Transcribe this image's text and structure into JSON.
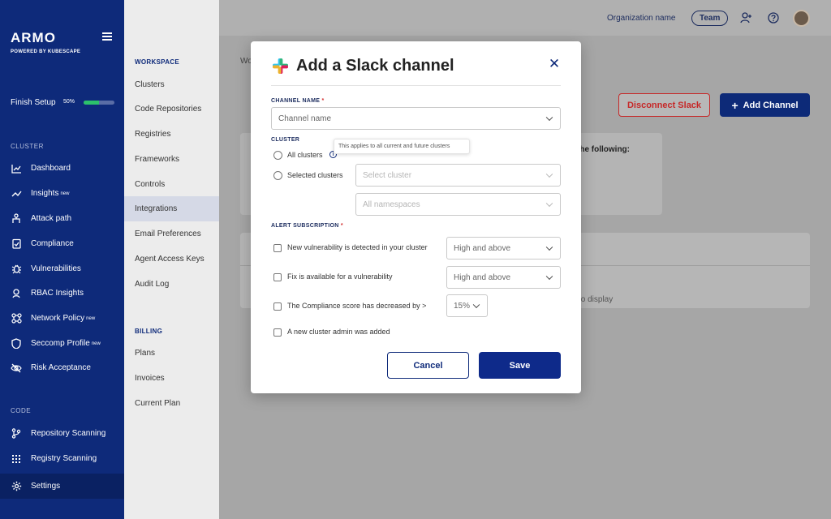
{
  "nav": {
    "logo": "ARMO",
    "powered": "POWERED BY KUBESCAPE",
    "setup_label": "Finish Setup",
    "setup_percent": "50%",
    "setup_progress": 0.5,
    "cluster_section": "CLUSTER",
    "code_section": "CODE",
    "items": [
      {
        "label": "Dashboard",
        "icon": "chart-icon",
        "new": ""
      },
      {
        "label": "Insights",
        "icon": "trend-icon",
        "new": "new"
      },
      {
        "label": "Attack path",
        "icon": "attack-path-icon",
        "new": ""
      },
      {
        "label": "Compliance",
        "icon": "clipboard-icon",
        "new": ""
      },
      {
        "label": "Vulnerabilities",
        "icon": "bug-icon",
        "new": ""
      },
      {
        "label": "RBAC Insights",
        "icon": "rbac-icon",
        "new": ""
      },
      {
        "label": "Network Policy",
        "icon": "network-icon",
        "new": "new"
      },
      {
        "label": "Seccomp Profile",
        "icon": "shield-icon",
        "new": "new"
      },
      {
        "label": "Risk Acceptance",
        "icon": "eye-off-icon",
        "new": ""
      }
    ],
    "code_items": [
      {
        "label": "Repository Scanning",
        "icon": "git-branch-icon"
      },
      {
        "label": "Registry Scanning",
        "icon": "grid-icon"
      }
    ],
    "settings_label": "Settings"
  },
  "subnav": {
    "workspace_section": "WORKSPACE",
    "workspace_links": [
      "Clusters",
      "Code Repositories",
      "Registries",
      "Frameworks",
      "Controls",
      "Integrations",
      "Email Preferences",
      "Agent Access Keys",
      "Audit Log"
    ],
    "billing_section": "BILLING",
    "billing_links": [
      "Plans",
      "Invoices",
      "Current Plan"
    ]
  },
  "topbar": {
    "org_name": "Organization name",
    "team": "Team"
  },
  "page": {
    "crumb": "Wo",
    "disconnect_label": "Disconnect Slack",
    "add_channel_label": "Add Channel",
    "follow_text": "the following:",
    "empty_text": "to display"
  },
  "modal": {
    "title": "Add a Slack channel",
    "channel_name_label": "CHANNEL NAME",
    "channel_name_placeholder": "Channel name",
    "cluster_label": "CLUSTER",
    "all_clusters": "All clusters",
    "tooltip": "This applies to all current and future clusters",
    "selected_clusters": "Selected clusters",
    "select_cluster_placeholder": "Select cluster",
    "namespaces_placeholder": "All namespaces",
    "alert_label": "ALERT SUBSCRIPTION",
    "alerts": [
      {
        "label": "New vulnerability is detected in your cluster",
        "value": "High and above"
      },
      {
        "label": "Fix is available for a vulnerability",
        "value": "High and above"
      },
      {
        "label": "The Compliance score has decreased by >",
        "value": "15%"
      },
      {
        "label": "A new cluster admin was added",
        "value": ""
      }
    ],
    "cancel": "Cancel",
    "save": "Save"
  },
  "colors": {
    "brand_navy": "#0e2a7a",
    "danger": "#c62828",
    "progress": "#2cc16b"
  }
}
